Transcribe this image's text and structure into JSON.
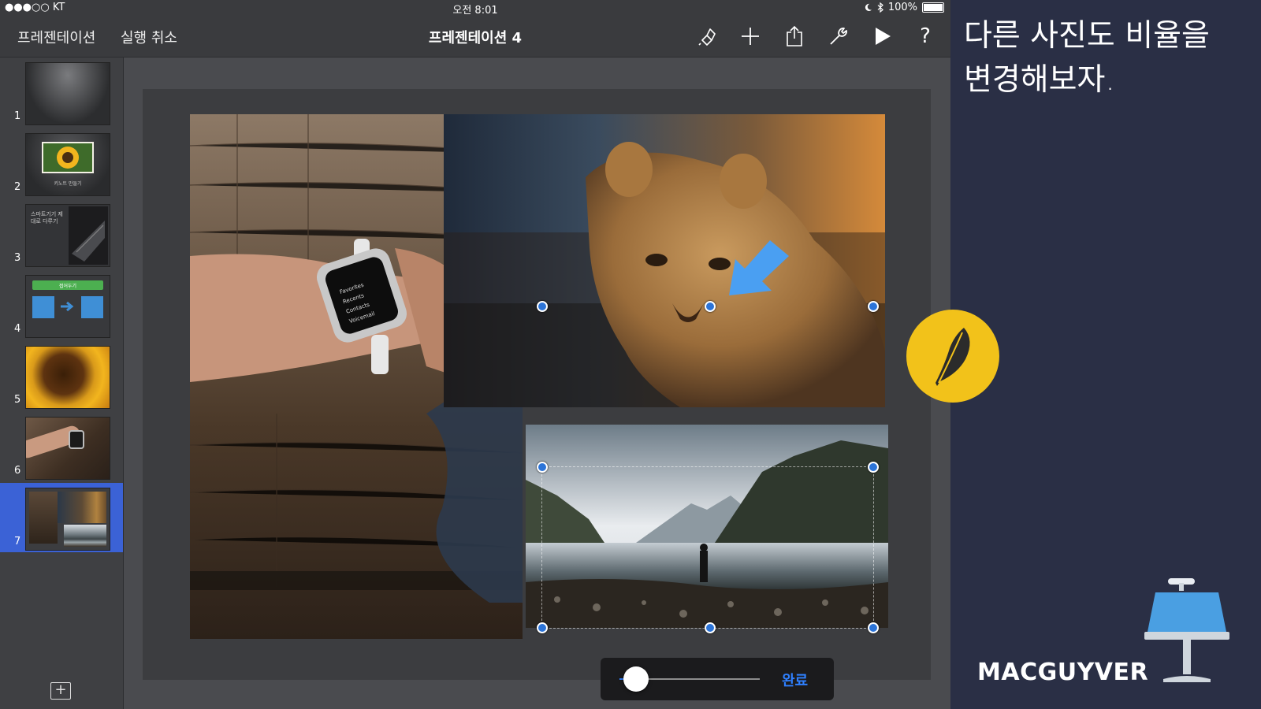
{
  "status_bar": {
    "carrier": "●●●○○ KT",
    "time": "오전 8:01",
    "battery": "100%"
  },
  "toolbar": {
    "back_label": "프레젠테이션",
    "undo_label": "실행 취소",
    "title": "프레젠테이션 4",
    "icons": [
      "format-brush-icon",
      "add-icon",
      "share-icon",
      "wrench-icon",
      "play-icon",
      "help-icon"
    ],
    "help_glyph": "?"
  },
  "slides": [
    {
      "number": "1",
      "caption": ""
    },
    {
      "number": "2",
      "caption": "키노트 만들기"
    },
    {
      "number": "3",
      "caption": "스마트기기 제대로 다루기"
    },
    {
      "number": "4",
      "caption": "접어두기"
    },
    {
      "number": "5",
      "caption": ""
    },
    {
      "number": "6",
      "caption": ""
    },
    {
      "number": "7",
      "caption": "",
      "selected": true
    }
  ],
  "add_slide_glyph": "+",
  "watch_menu": [
    "Favorites",
    "Recents",
    "Contacts",
    "Voicemail"
  ],
  "slider": {
    "value_fraction": 0.12,
    "done_label": "완료"
  },
  "caption": {
    "line1": "다른 사진도 비율을",
    "line2": "변경해보자."
  },
  "brand": "MACGUYVER",
  "colors": {
    "accent": "#2f7bf5",
    "selection": "#3b62d6",
    "badge": "#f2c21a",
    "background": "#2a2f45"
  }
}
